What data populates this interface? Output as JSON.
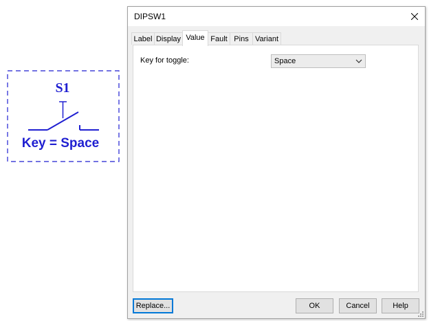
{
  "schematic": {
    "ref": "S1",
    "label": "Key = Space",
    "color": "#1f1fd1"
  },
  "dialog": {
    "title": "DIPSW1",
    "close_icon": "close-icon",
    "tabs": [
      {
        "label": "Label",
        "active": false
      },
      {
        "label": "Display",
        "active": false
      },
      {
        "label": "Value",
        "active": true
      },
      {
        "label": "Fault",
        "active": false
      },
      {
        "label": "Pins",
        "active": false
      },
      {
        "label": "Variant",
        "active": false
      }
    ],
    "value_tab": {
      "key_label": "Key for toggle:",
      "key_value": "Space"
    },
    "buttons": {
      "replace": "Replace...",
      "ok": "OK",
      "cancel": "Cancel",
      "help": "Help"
    }
  }
}
